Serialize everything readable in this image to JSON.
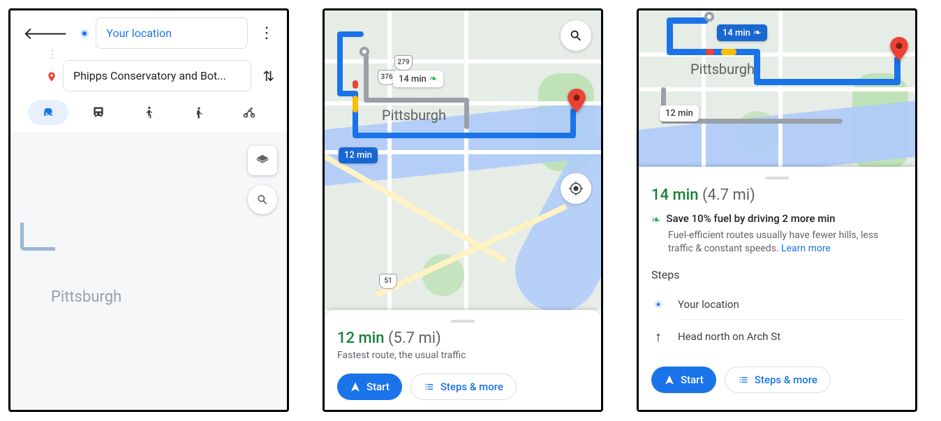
{
  "screen1": {
    "start_field": "Your location",
    "dest_field": "Phipps Conservatory and Bot...",
    "map_city": "Pittsburgh",
    "modes": {
      "drive": "drive-icon",
      "transit": "transit-icon",
      "walk": "walk-icon",
      "rideshare": "rideshare-icon",
      "bike": "bike-icon"
    }
  },
  "screen2": {
    "city": "Pittsburgh",
    "primary_label": "12 min",
    "alt_label": "14 min",
    "hwy1": "376",
    "hwy2": "279",
    "hwy3": "51",
    "sheet": {
      "duration": "12 min",
      "distance": "(5.7 mi)",
      "subline": "Fastest route, the usual traffic",
      "start_btn": "Start",
      "steps_btn": "Steps & more"
    }
  },
  "screen3": {
    "city": "Pittsburgh",
    "primary_label": "14 min",
    "alt_label": "12 min",
    "sheet": {
      "duration": "14 min",
      "distance": "(4.7 mi)",
      "eco_title": "Save 10% fuel by driving 2 more min",
      "eco_detail": "Fuel-efficient routes usually have fewer hills, less traffic & constant speeds. ",
      "learn_more": "Learn more",
      "steps_header": "Steps",
      "step1": "Your location",
      "step2": "Head north on Arch St",
      "start_btn": "Start",
      "steps_btn": "Steps & more"
    }
  }
}
